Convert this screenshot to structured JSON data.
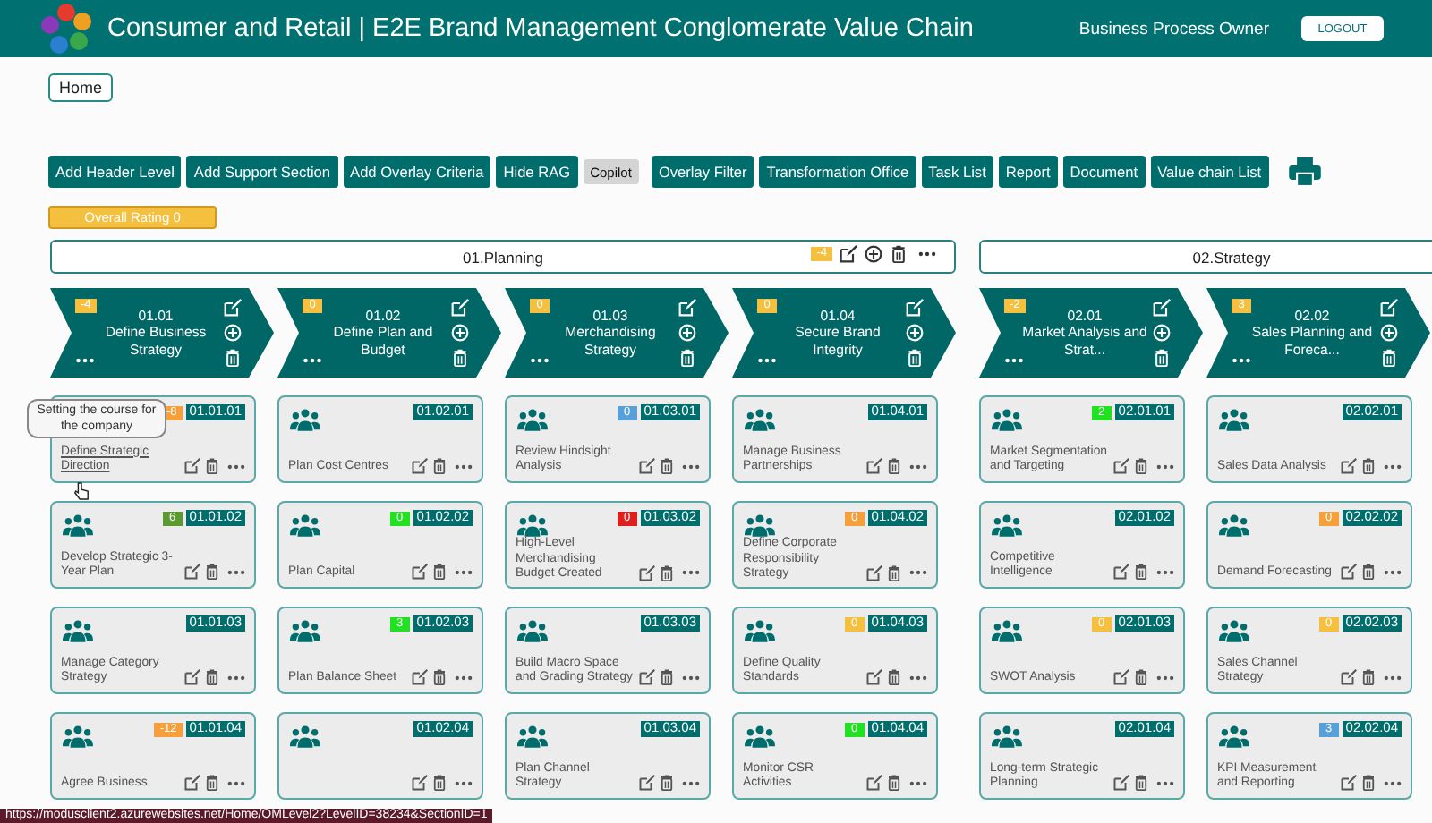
{
  "header": {
    "title": "Consumer and Retail | E2E Brand Management Conglomerate Value Chain",
    "role": "Business Process Owner",
    "logout": "LOGOUT"
  },
  "breadcrumb": "Home",
  "toolbar": [
    {
      "label": "Add Header Level",
      "kind": "primary"
    },
    {
      "label": "Add Support Section",
      "kind": "primary"
    },
    {
      "label": "Add Overlay Criteria",
      "kind": "primary"
    },
    {
      "label": "Hide RAG",
      "kind": "primary"
    },
    {
      "label": "Copilot",
      "kind": "muted"
    },
    {
      "label": "Overlay Filter",
      "kind": "primary"
    },
    {
      "label": "Transformation Office",
      "kind": "primary"
    },
    {
      "label": "Task List",
      "kind": "primary"
    },
    {
      "label": "Report",
      "kind": "primary"
    },
    {
      "label": "Document",
      "kind": "primary"
    },
    {
      "label": "Value chain List",
      "kind": "primary"
    }
  ],
  "overall_rating": "Overall Rating 0",
  "sections": [
    {
      "title": "01.Planning",
      "rating": "-4",
      "groups": [
        {
          "code": "01.01",
          "name": "Define Business Strategy",
          "rating": "-4",
          "cards": [
            {
              "code": "01.01.01",
              "rating": "-8",
              "color": "#f5a03a",
              "name": "Define Strategic Direction",
              "tooltip": "Setting the course for the company"
            },
            {
              "code": "01.01.02",
              "rating": "6",
              "color": "#5a9a30",
              "name": "Develop Strategic 3-Year Plan"
            },
            {
              "code": "01.01.03",
              "name": "Manage Category Strategy"
            },
            {
              "code": "01.01.04",
              "rating": "-12",
              "color": "#f5a03a",
              "name": "Agree Business"
            }
          ]
        },
        {
          "code": "01.02",
          "name": "Define Plan and Budget",
          "rating": "0",
          "cards": [
            {
              "code": "01.02.01",
              "name": "Plan Cost Centres"
            },
            {
              "code": "01.02.02",
              "rating": "0",
              "color": "#22e022",
              "name": "Plan Capital"
            },
            {
              "code": "01.02.03",
              "rating": "3",
              "color": "#22e022",
              "name": "Plan Balance Sheet"
            },
            {
              "code": "01.02.04"
            }
          ]
        },
        {
          "code": "01.03",
          "name": "Merchandising Strategy",
          "rating": "0",
          "cards": [
            {
              "code": "01.03.01",
              "rating": "0",
              "color": "#5aa0d8",
              "name": "Review Hindsight Analysis"
            },
            {
              "code": "01.03.02",
              "rating": "0",
              "color": "#e02020",
              "name": "High-Level Merchandising Budget Created"
            },
            {
              "code": "01.03.03",
              "name": "Build Macro Space and Grading Strategy"
            },
            {
              "code": "01.03.04",
              "name": "Plan Channel Strategy"
            }
          ]
        },
        {
          "code": "01.04",
          "name": "Secure Brand Integrity",
          "rating": "0",
          "cards": [
            {
              "code": "01.04.01",
              "name": "Manage Business Partnerships"
            },
            {
              "code": "01.04.02",
              "rating": "0",
              "color": "#f5a03a",
              "name": "Define Corporate Responsibility Strategy"
            },
            {
              "code": "01.04.03",
              "rating": "0",
              "color": "#f5c040",
              "name": "Define Quality Standards"
            },
            {
              "code": "01.04.04",
              "rating": "0",
              "color": "#22e022",
              "name": "Monitor CSR Activities"
            }
          ]
        }
      ]
    },
    {
      "title": "02.Strategy",
      "groups": [
        {
          "code": "02.01",
          "name": "Market Analysis and Strat...",
          "rating": "-2",
          "cards": [
            {
              "code": "02.01.01",
              "rating": "2",
              "color": "#22e022",
              "name": "Market Segmentation and Targeting"
            },
            {
              "code": "02.01.02",
              "name": "Competitive Intelligence"
            },
            {
              "code": "02.01.03",
              "rating": "0",
              "color": "#f5c040",
              "name": "SWOT Analysis"
            },
            {
              "code": "02.01.04",
              "name": "Long-term Strategic Planning"
            }
          ]
        },
        {
          "code": "02.02",
          "name": "Sales Planning and Foreca...",
          "rating": "3",
          "cards": [
            {
              "code": "02.02.01",
              "name": "Sales Data Analysis"
            },
            {
              "code": "02.02.02",
              "rating": "0",
              "color": "#f5a03a",
              "name": "Demand Forecasting"
            },
            {
              "code": "02.02.03",
              "rating": "0",
              "color": "#f5c040",
              "name": "Sales Channel Strategy"
            },
            {
              "code": "02.02.04",
              "rating": "3",
              "color": "#5aa0d8",
              "name": "KPI Measurement and Reporting"
            }
          ]
        }
      ]
    }
  ],
  "status_url": "https://modusclient2.azurewebsites.net/Home/OMLevel2?LevelID=38234&SectionID=1"
}
